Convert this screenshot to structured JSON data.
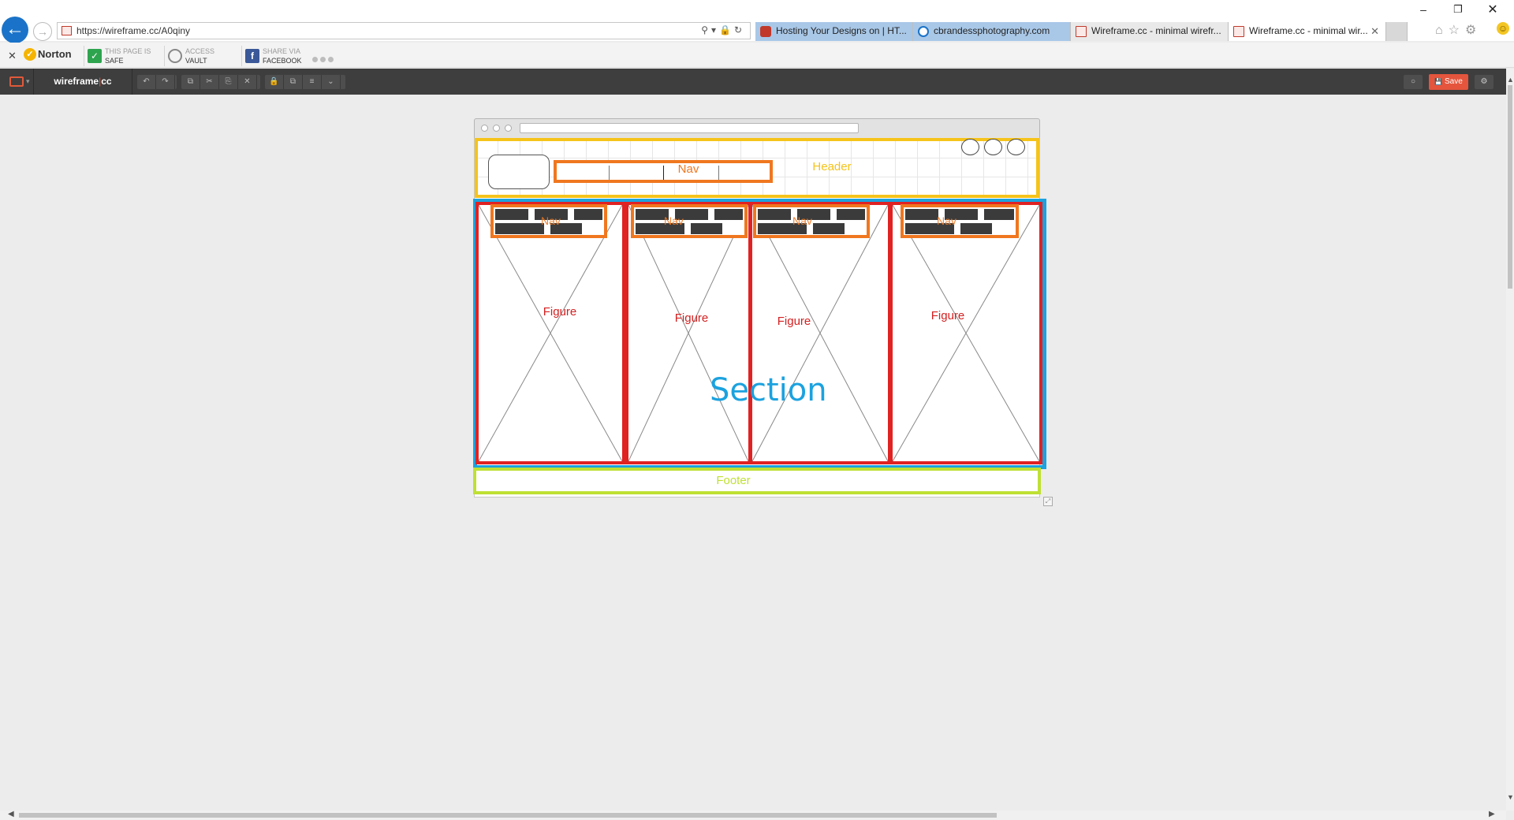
{
  "browser": {
    "url": "https://wireframe.cc/A0qiny",
    "tabs": [
      {
        "title": "Hosting Your Designs on | HT...",
        "favicon": "red-globe-icon"
      },
      {
        "title": "cbrandessphotography.com",
        "favicon": "ie-icon"
      },
      {
        "title": "Wireframe.cc - minimal wirefr...",
        "favicon": "wireframe-icon"
      },
      {
        "title": "Wireframe.cc - minimal wir...",
        "favicon": "wireframe-icon",
        "active": true,
        "close": "✕"
      }
    ],
    "window_controls": {
      "minimize": "–",
      "maximize": "❐",
      "close": "✕"
    }
  },
  "norton": {
    "close": "✕",
    "brand": "Norton",
    "items": [
      {
        "line1": "THIS PAGE IS",
        "line2": "SAFE",
        "icon": "check-icon"
      },
      {
        "line1": "ACCESS",
        "line2": "VAULT",
        "icon": "vault-icon"
      },
      {
        "line1": "SHARE VIA",
        "line2": "FACEBOOK",
        "icon": "facebook-icon"
      }
    ]
  },
  "toolbar": {
    "brand_left": "wireframe",
    "brand_sep": "|",
    "brand_right": "cc",
    "buttons_group1": [
      "↶",
      "↷"
    ],
    "buttons_group2": [
      "⧉",
      "✂",
      "⎘",
      "✕"
    ],
    "buttons_group3": [
      "🔒",
      "⧉",
      "≡",
      "⌄"
    ],
    "save_label": "Save",
    "save_icon": "💾"
  },
  "wireframe": {
    "header_label": "Header",
    "header_nav_label": "Nav",
    "section_label": "Section",
    "footer_label": "Footer",
    "figures": [
      {
        "label": "Figure",
        "nav_label": "Nav"
      },
      {
        "label": "Figure",
        "nav_label": "Nav"
      },
      {
        "label": "Figure",
        "nav_label": "Nav"
      },
      {
        "label": "Figure",
        "nav_label": "Nav"
      }
    ]
  },
  "colors": {
    "header": "#f5c31b",
    "nav": "#f0771f",
    "section": "#1ba2df",
    "figure": "#e02222",
    "footer": "#bfe034",
    "save_button": "#e5553d"
  }
}
